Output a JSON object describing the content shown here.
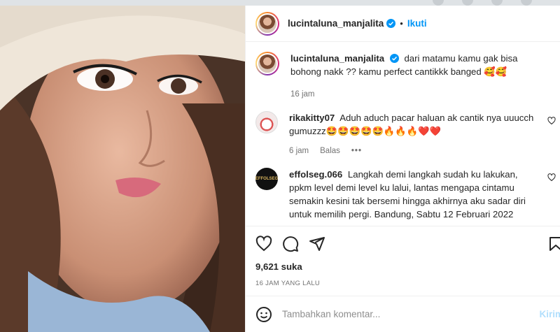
{
  "post": {
    "username": "lucintaluna_manjalita",
    "separator": "•",
    "follow_label": "Ikuti",
    "caption": "dari matamu kamu gak bisa bohong nakk ?? kamu perfect cantikkk banged 🥰🥰",
    "caption_time": "16 jam"
  },
  "comments": [
    {
      "username": "rikakitty07",
      "text": "Aduh aduch pacar haluan ak cantik nya uuucch gumuzzz🤩🤩🤩🤩🤩🔥🔥🔥❤️❤️",
      "time": "6 jam",
      "reply_label": "Balas",
      "more": "•••"
    },
    {
      "username": "effolseg.066",
      "text": "Langkah demi langkah sudah ku lakukan, ppkm level demi level ku lalui, lantas mengapa cintamu semakin kesini tak bersemi hingga akhirnya aku sadar diri untuk memilih pergi. Bandung, Sabtu 12 Februari 2022"
    }
  ],
  "stats": {
    "likes": "9,621 suka",
    "posted_ago": "16 JAM YANG LALU"
  },
  "composer": {
    "placeholder": "Tambahkan komentar...",
    "post_label": "Kirim"
  },
  "icons": [
    "verified-badge-icon",
    "heart-icon",
    "comment-icon",
    "share-icon",
    "bookmark-icon",
    "emoji-icon"
  ],
  "colors": {
    "accent": "#0095f6",
    "text": "#262626",
    "muted": "#737373",
    "post_disabled": "#b2dffc"
  }
}
